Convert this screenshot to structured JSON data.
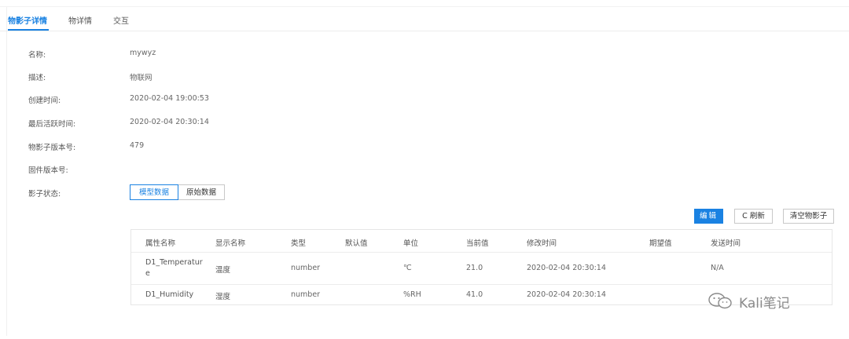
{
  "tabs": [
    {
      "label": "物影子详情",
      "active": true
    },
    {
      "label": "物详情",
      "active": false
    },
    {
      "label": "交互",
      "active": false
    }
  ],
  "details": {
    "name_label": "名称:",
    "name_value": "mywyz",
    "desc_label": "描述:",
    "desc_value": "物联网",
    "created_label": "创建时间:",
    "created_value": "2020-02-04 19:00:53",
    "active_label": "最后活跃时间:",
    "active_value": "2020-02-04 20:30:14",
    "shadow_ver_label": "物影子版本号:",
    "shadow_ver_value": "479",
    "firmware_label": "固件版本号:",
    "firmware_value": "",
    "status_label": "影子状态:"
  },
  "status_toggle": {
    "model_label": "模型数据",
    "raw_label": "原始数据",
    "selected": "模型数据"
  },
  "toolbar": {
    "edit_label": "编辑",
    "refresh_label": "C 刷新",
    "clear_label": "清空物影子"
  },
  "table": {
    "headers": [
      "属性名称",
      "显示名称",
      "类型",
      "默认值",
      "单位",
      "当前值",
      "修改时间",
      "期望值",
      "发送时间"
    ],
    "rows": [
      {
        "name_line1": "D1_Temperatur",
        "name_line2": "e",
        "display": "温度",
        "type": "number",
        "default": "",
        "unit": "℃",
        "current": "21.0",
        "modified": "2020-02-04 20:30:14",
        "expected": "",
        "sent": "N/A"
      },
      {
        "name_line1": "D1_Humidity",
        "name_line2": "",
        "display": "湿度",
        "type": "number",
        "default": "",
        "unit": "%RH",
        "current": "41.0",
        "modified": "2020-02-04 20:30:14",
        "expected": "",
        "sent": ""
      }
    ]
  },
  "watermark": {
    "text": "Kali笔记",
    "icon": "wechat-icon"
  },
  "colors": {
    "accent": "#1a82e2"
  }
}
